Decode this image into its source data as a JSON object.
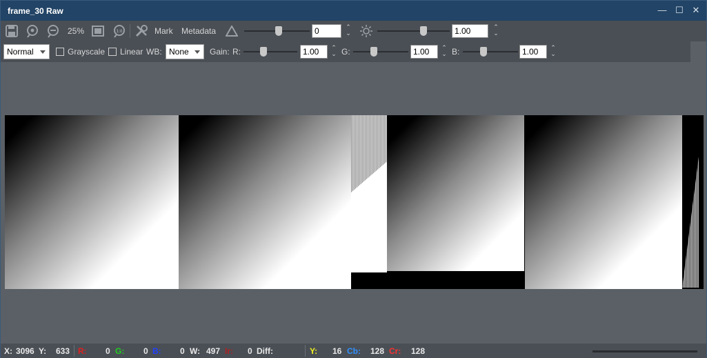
{
  "window": {
    "title": "frame_30 Raw",
    "controls": {
      "minimize": "—",
      "maximize": "☐",
      "close": "✕"
    }
  },
  "toolbar1": {
    "zoom_label": "25%",
    "mark_label": "Mark",
    "metadata_label": "Metadata",
    "contrast_value": "0",
    "brightness_value": "1.00"
  },
  "toolbar2": {
    "mode_value": "Normal",
    "grayscale_label": "Grayscale",
    "linear_label": "Linear",
    "wb_label": "WB:",
    "wb_value": "None",
    "gain_label": "Gain:",
    "r_label": "R:",
    "r_value": "1.00",
    "g_label": "G:",
    "g_value": "1.00",
    "b_label": "B:",
    "b_value": "1.00"
  },
  "status": {
    "x_label": "X:",
    "x_value": "3096",
    "y_label": "Y:",
    "y_value": "633",
    "r_label": "R:",
    "r_value": "0",
    "g_label": "G:",
    "g_value": "0",
    "b_label": "B:",
    "b_value": "0",
    "w_label": "W:",
    "w_value": "497",
    "ir_label": "Ir:",
    "ir_value": "0",
    "diff_label": "Diff:",
    "yy_label": "Y:",
    "yy_value": "16",
    "cb_label": "Cb:",
    "cb_value": "128",
    "cr_label": "Cr:",
    "cr_value": "128",
    "colors": {
      "r": "#e02020",
      "g": "#20d020",
      "b": "#2040ff",
      "ir": "#b02020",
      "y": "#f0f020",
      "cb": "#3090ff",
      "cr": "#ff3030"
    }
  }
}
